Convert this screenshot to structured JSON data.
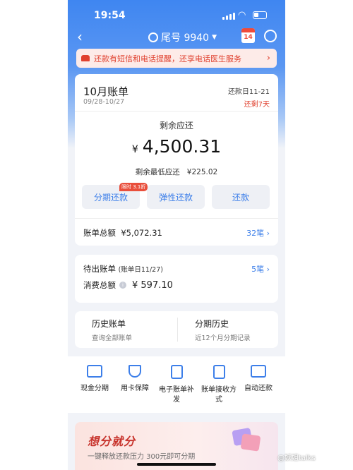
{
  "status_bar": {
    "time": "19:54"
  },
  "nav": {
    "account": "尾号 9940",
    "calendar_day": "14"
  },
  "alert": {
    "text": "还款有短信和电话提醒，还享电话医生服务",
    "arrow": "›"
  },
  "bill": {
    "title": "10月账单",
    "range": "09/28-10/27",
    "due": "还款日11-21",
    "days_left": "还剩7天",
    "remain_label": "剩余应还",
    "currency": "¥",
    "amount": "4,500.31",
    "min_label": "剩余最低应还",
    "min_value": "¥225.02",
    "buttons": [
      "分期还款",
      "弹性还款",
      "还款"
    ],
    "discount_tag": "限时 3.1折",
    "total_label": "账单总额",
    "total_value": "¥5,072.31",
    "total_count": "32笔 ›"
  },
  "pending": {
    "label": "待出账单",
    "sub": "(账单日11/27)",
    "count": "5笔 ›",
    "spend_label": "消费总额",
    "spend_value": "¥ 597.10"
  },
  "history": {
    "bills_title": "历史账单",
    "bills_sub": "查询全部账单",
    "installment_title": "分期历史",
    "installment_sub": "近12个月分期记录"
  },
  "actions": [
    {
      "label": "现金分期",
      "icon": "card-cash-icon"
    },
    {
      "label": "用卡保障",
      "icon": "shield-check-icon"
    },
    {
      "label": "电子账单补发",
      "icon": "document-icon"
    },
    {
      "label": "账单接收方式",
      "icon": "doc-settings-icon"
    },
    {
      "label": "自动还款",
      "icon": "card-auto-icon"
    }
  ],
  "promo": {
    "title": "想分就分",
    "subtitle": "一键释放还款压力 300元即可分期"
  },
  "watermark": "@妖姐talks",
  "colors": {
    "brand_blue": "#3d7fe9",
    "alert_red": "#e0412f",
    "header_blue": "#3f86f1"
  }
}
